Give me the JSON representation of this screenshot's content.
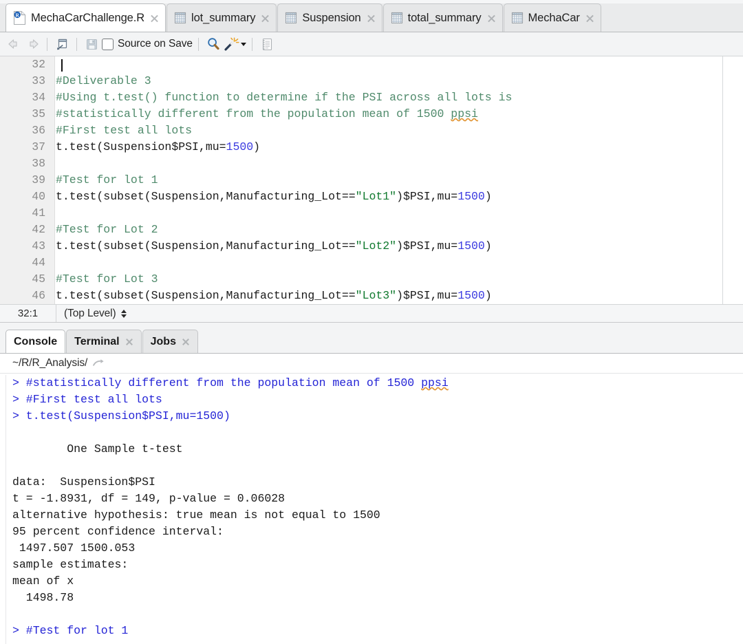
{
  "editor": {
    "tabs": [
      {
        "label": "MechaCarChallenge.R",
        "icon": "r-script-icon",
        "active": true
      },
      {
        "label": "lot_summary",
        "icon": "data-frame-icon",
        "active": false
      },
      {
        "label": "Suspension",
        "icon": "data-frame-icon",
        "active": false
      },
      {
        "label": "total_summary",
        "icon": "data-frame-icon",
        "active": false
      },
      {
        "label": "MechaCar",
        "icon": "data-frame-icon",
        "active": false
      }
    ],
    "toolbar": {
      "back_icon": "back-arrow-icon",
      "forward_icon": "forward-arrow-icon",
      "popout_icon": "show-in-new-window-icon",
      "save_icon": "save-icon",
      "source_on_save_label": "Source on Save",
      "find_icon": "search-icon",
      "code_tools_icon": "magic-wand-icon",
      "compile_report_icon": "compile-report-icon"
    },
    "status": {
      "position": "32:1",
      "scope": "(Top Level)"
    },
    "lines": [
      {
        "n": "32",
        "tokens": []
      },
      {
        "n": "33",
        "tokens": [
          {
            "c": "cmt",
            "t": "#Deliverable 3"
          }
        ]
      },
      {
        "n": "34",
        "tokens": [
          {
            "c": "cmt",
            "t": "#Using t.test() function to determine if the PSI across all lots is"
          }
        ]
      },
      {
        "n": "35",
        "tokens": [
          {
            "c": "cmt",
            "t": "#statistically different from the population mean of 1500 "
          },
          {
            "c": "sp",
            "t": "ppsi"
          }
        ]
      },
      {
        "n": "36",
        "tokens": [
          {
            "c": "cmt",
            "t": "#First test all lots"
          }
        ]
      },
      {
        "n": "37",
        "tokens": [
          {
            "c": "pln",
            "t": "t.test(Suspension$PSI,mu="
          },
          {
            "c": "num",
            "t": "1500"
          },
          {
            "c": "pln",
            "t": ")"
          }
        ]
      },
      {
        "n": "38",
        "tokens": []
      },
      {
        "n": "39",
        "tokens": [
          {
            "c": "cmt",
            "t": "#Test for lot 1"
          }
        ]
      },
      {
        "n": "40",
        "tokens": [
          {
            "c": "pln",
            "t": "t.test(subset(Suspension,Manufacturing_Lot=="
          },
          {
            "c": "str",
            "t": "\"Lot1\""
          },
          {
            "c": "pln",
            "t": ")$PSI,mu="
          },
          {
            "c": "num",
            "t": "1500"
          },
          {
            "c": "pln",
            "t": ")"
          }
        ]
      },
      {
        "n": "41",
        "tokens": []
      },
      {
        "n": "42",
        "tokens": [
          {
            "c": "cmt",
            "t": "#Test for Lot 2"
          }
        ]
      },
      {
        "n": "43",
        "tokens": [
          {
            "c": "pln",
            "t": "t.test(subset(Suspension,Manufacturing_Lot=="
          },
          {
            "c": "str",
            "t": "\"Lot2\""
          },
          {
            "c": "pln",
            "t": ")$PSI,mu="
          },
          {
            "c": "num",
            "t": "1500"
          },
          {
            "c": "pln",
            "t": ")"
          }
        ]
      },
      {
        "n": "44",
        "tokens": []
      },
      {
        "n": "45",
        "tokens": [
          {
            "c": "cmt",
            "t": "#Test for Lot 3"
          }
        ]
      },
      {
        "n": "46",
        "tokens": [
          {
            "c": "pln",
            "t": "t.test(subset(Suspension,Manufacturing_Lot=="
          },
          {
            "c": "str",
            "t": "\"Lot3\""
          },
          {
            "c": "pln",
            "t": ")$PSI,mu="
          },
          {
            "c": "num",
            "t": "1500"
          },
          {
            "c": "pln",
            "t": ")"
          }
        ]
      }
    ]
  },
  "console": {
    "tabs": [
      {
        "label": "Console",
        "active": true,
        "closable": false
      },
      {
        "label": "Terminal",
        "active": false,
        "closable": true
      },
      {
        "label": "Jobs",
        "active": false,
        "closable": true
      }
    ],
    "working_dir": "~/R/R_Analysis/",
    "working_dir_icon": "go-to-directory-icon",
    "output": [
      {
        "kind": "input",
        "tokens": [
          {
            "t": "> #statistically different from the population mean of 1500 "
          },
          {
            "c": "sp",
            "t": "ppsi"
          }
        ]
      },
      {
        "kind": "input",
        "tokens": [
          {
            "t": "> #First test all lots"
          }
        ]
      },
      {
        "kind": "input",
        "tokens": [
          {
            "t": "> t.test(Suspension$PSI,mu=1500)"
          }
        ]
      },
      {
        "kind": "output",
        "tokens": [
          {
            "t": ""
          }
        ]
      },
      {
        "kind": "output",
        "tokens": [
          {
            "t": "        One Sample t-test"
          }
        ]
      },
      {
        "kind": "output",
        "tokens": [
          {
            "t": ""
          }
        ]
      },
      {
        "kind": "output",
        "tokens": [
          {
            "t": "data:  Suspension$PSI"
          }
        ]
      },
      {
        "kind": "output",
        "tokens": [
          {
            "t": "t = -1.8931, df = 149, p-value = 0.06028"
          }
        ]
      },
      {
        "kind": "output",
        "tokens": [
          {
            "t": "alternative hypothesis: true mean is not equal to 1500"
          }
        ]
      },
      {
        "kind": "output",
        "tokens": [
          {
            "t": "95 percent confidence interval:"
          }
        ]
      },
      {
        "kind": "output",
        "tokens": [
          {
            "t": " 1497.507 1500.053"
          }
        ]
      },
      {
        "kind": "output",
        "tokens": [
          {
            "t": "sample estimates:"
          }
        ]
      },
      {
        "kind": "output",
        "tokens": [
          {
            "t": "mean of x"
          }
        ]
      },
      {
        "kind": "output",
        "tokens": [
          {
            "t": "  1498.78"
          }
        ]
      },
      {
        "kind": "output",
        "tokens": [
          {
            "t": ""
          }
        ]
      },
      {
        "kind": "input",
        "tokens": [
          {
            "t": "> #Test for lot 1"
          }
        ]
      }
    ]
  },
  "colors": {
    "comment": "#4f8a6b",
    "string": "#117a2f",
    "number": "#3a3ae0",
    "plain": "#1a1a1a",
    "console_input": "#2424d6",
    "spellcheck_underline": "#e0922f",
    "tab_active_bg": "#ffffff",
    "tab_inactive_bg": "#e6e7e8",
    "gutter_bg": "#f0f0f0"
  }
}
